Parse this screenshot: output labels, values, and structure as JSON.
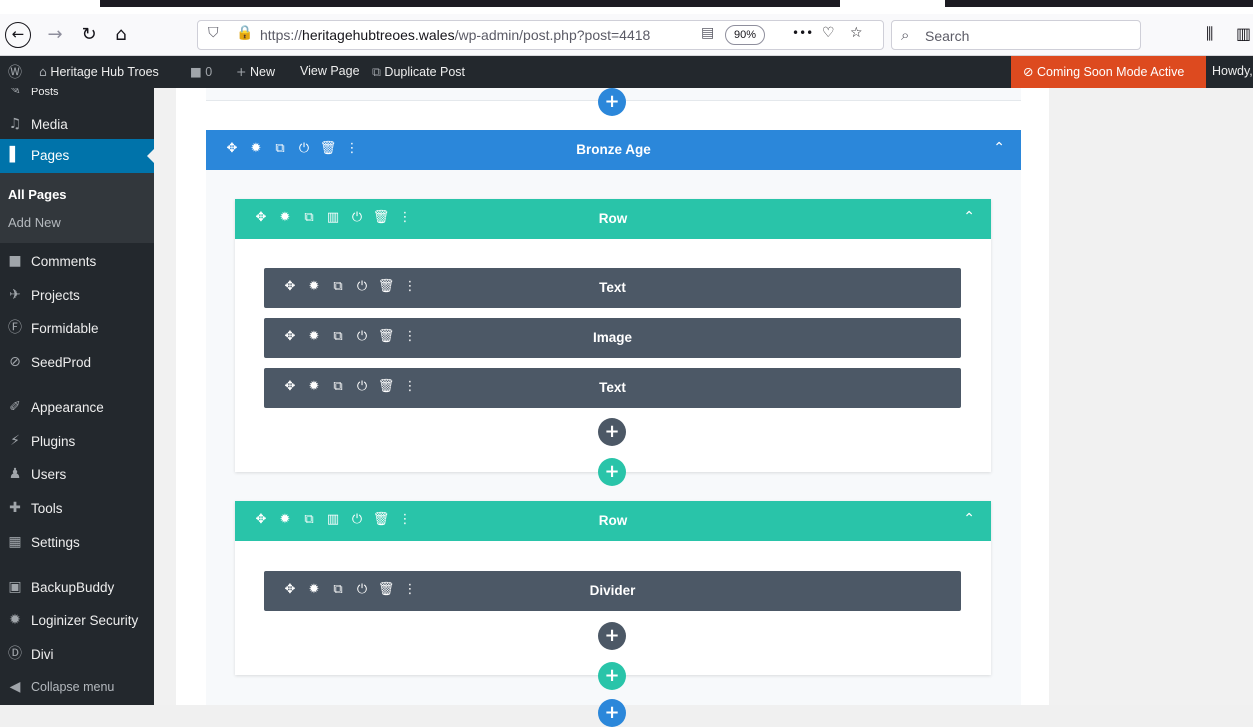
{
  "browser": {
    "url_host": "heritagehubtreoes.wales",
    "url_prefix": "https://",
    "url_path": "/wp-admin/post.php?post=4418",
    "zoom": "90%",
    "search_placeholder": "Search",
    "menu_dots": "•••"
  },
  "adminbar": {
    "site_name": "Heritage Hub Troes",
    "comments_count": "0",
    "new_label": "New",
    "view_page_label": "View Page",
    "duplicate_label": "Duplicate Post",
    "coming_soon": "Coming Soon Mode Active",
    "howdy": "Howdy,"
  },
  "sidebar": {
    "items": [
      {
        "label": "Posts",
        "icon": "pin-icon"
      },
      {
        "label": "Media",
        "icon": "media-icon"
      },
      {
        "label": "Pages",
        "icon": "pages-icon"
      },
      {
        "label": "Comments",
        "icon": "comments-icon"
      },
      {
        "label": "Projects",
        "icon": "projects-icon"
      },
      {
        "label": "Formidable",
        "icon": "formidable-icon"
      },
      {
        "label": "SeedProd",
        "icon": "seedprod-icon"
      },
      {
        "label": "Appearance",
        "icon": "brush-icon"
      },
      {
        "label": "Plugins",
        "icon": "plugin-icon"
      },
      {
        "label": "Users",
        "icon": "users-icon"
      },
      {
        "label": "Tools",
        "icon": "wrench-icon"
      },
      {
        "label": "Settings",
        "icon": "settings-icon"
      },
      {
        "label": "BackupBuddy",
        "icon": "backup-icon"
      },
      {
        "label": "Loginizer Security",
        "icon": "gear-icon"
      },
      {
        "label": "Divi",
        "icon": "divi-icon"
      },
      {
        "label": "Collapse menu",
        "icon": "collapse-icon"
      }
    ],
    "submenu": {
      "all_pages": "All Pages",
      "add_new": "Add New"
    }
  },
  "builder": {
    "section_title": "Bronze Age",
    "row1": {
      "title": "Row",
      "modules": [
        "Text",
        "Image",
        "Text"
      ]
    },
    "row2": {
      "title": "Row",
      "modules": [
        "Divider"
      ]
    },
    "colors": {
      "section": "#2b87da",
      "row": "#29c4a9",
      "module": "#4c5866"
    }
  }
}
